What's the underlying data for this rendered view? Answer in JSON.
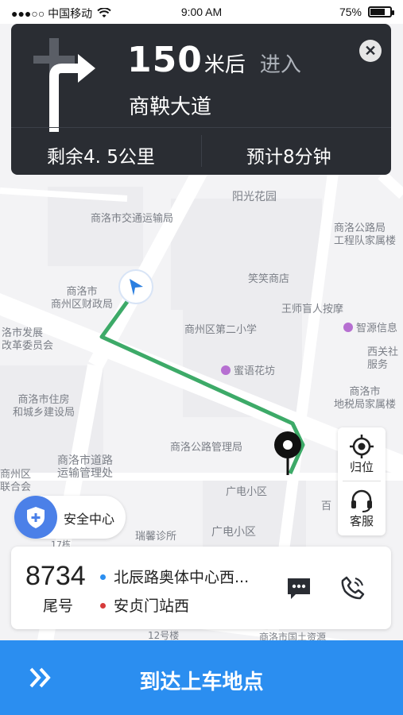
{
  "status_bar": {
    "carrier": "●●●○○ 中国移动",
    "time": "9:00 AM",
    "battery_percent": "75%",
    "battery_level": 0.75
  },
  "navigation": {
    "distance_value": "150",
    "distance_unit": "米后",
    "action": "进入",
    "road_name": "商鞅大道",
    "remaining": "剩余4. 5公里",
    "eta": "预计8分钟",
    "turn_icon": "turn-right-arrow",
    "close_icon": "close-x"
  },
  "map": {
    "labels": [
      "阳光花园",
      "商洛市交通运输局",
      "商洛公路局\n工程队家属楼",
      "笑笑商店",
      "商洛市\n商州区财政局",
      "王师盲人按摩",
      "商州区第二小学",
      "智源信息",
      "洛市发展\n改革委员会",
      "西关社\n服务",
      "蜜语花坊",
      "商洛市\n地税局家属楼",
      "商洛市住房\n和城乡建设局",
      "商洛公路管理局",
      "商洛市道路\n运输管理处",
      "广电小区",
      "商州区\n联合会",
      "百",
      "广电小区",
      "瑞馨诊所",
      "17栋",
      "12号楼",
      "商洛市国土资源"
    ],
    "route_color": "#3daa68"
  },
  "side_controls": {
    "locate_label": "归位",
    "service_label": "客服"
  },
  "safety_center": {
    "label": "安全中心"
  },
  "trip": {
    "plate_number": "8734",
    "plate_label": "尾号",
    "start_location": "北辰路奥体中心西...",
    "end_location": "安贞门站西",
    "start_color": "#2b8ef0",
    "end_color": "#d63a3a"
  },
  "action_bar": {
    "label": "到达上车地点",
    "color": "#2b8ef0"
  }
}
